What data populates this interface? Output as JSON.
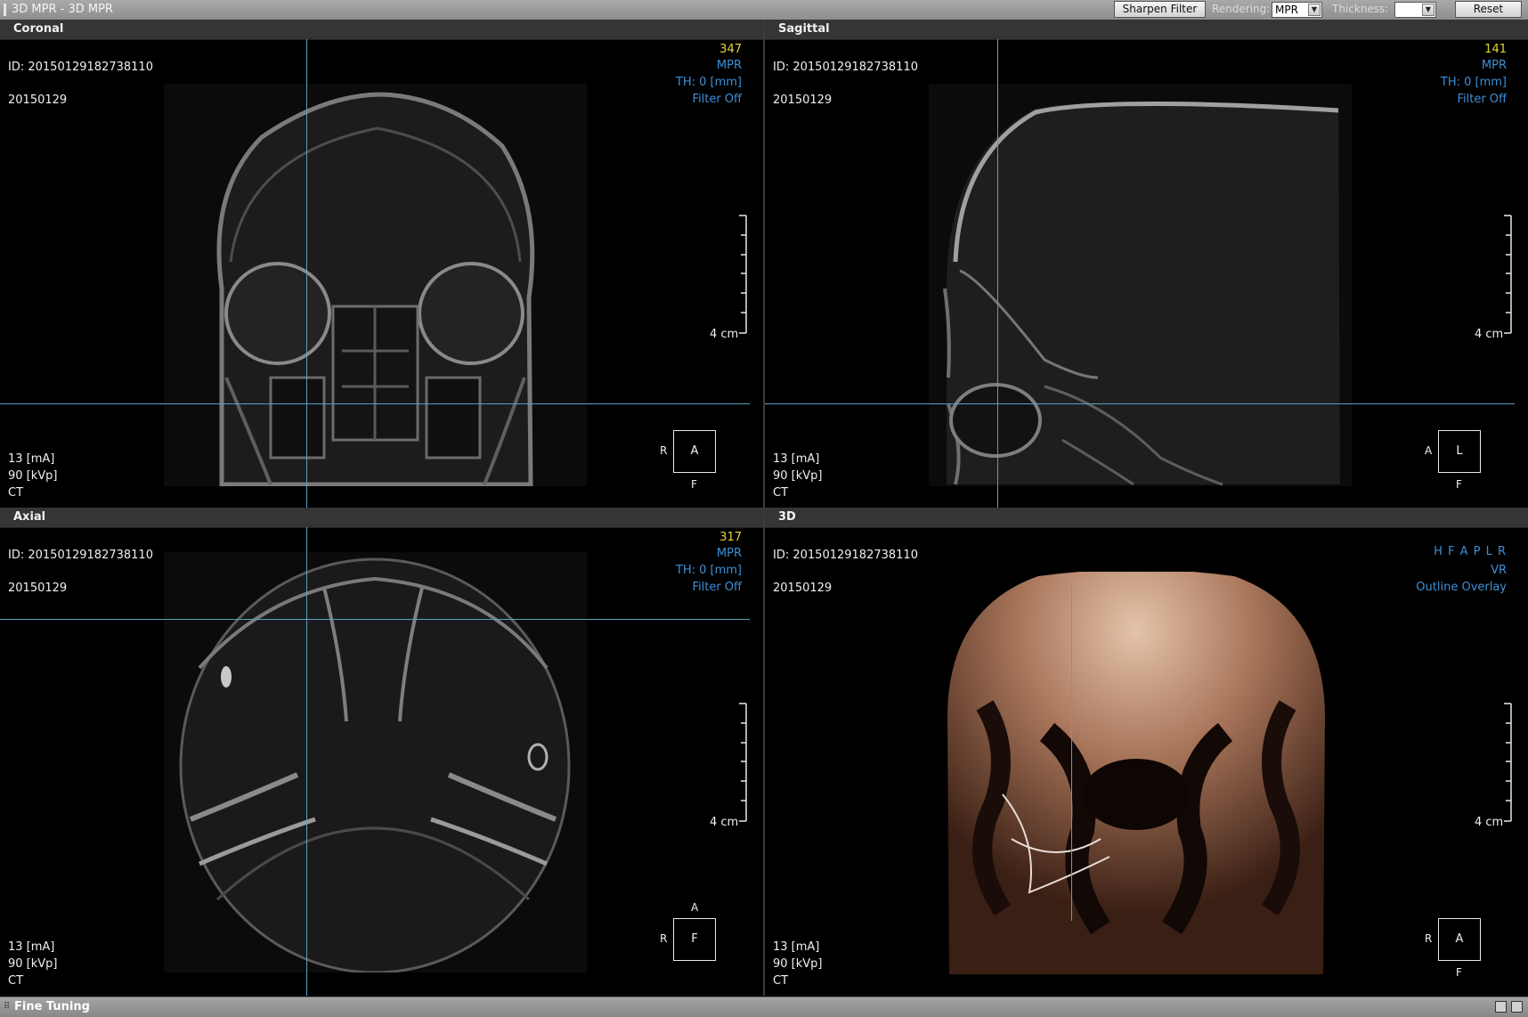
{
  "app": {
    "title": "3D MPR - 3D MPR"
  },
  "toolbar": {
    "sharpen_label": "Sharpen Filter",
    "rendering_label": "Rendering:",
    "rendering_value": "MPR",
    "thickness_label": "Thickness:",
    "thickness_value": "",
    "reset_label": "Reset"
  },
  "viewports": [
    {
      "title": "Coronal",
      "id": "ID: 20150129182738110",
      "date": "20150129",
      "slice": "347",
      "mode": "MPR",
      "thickness": "TH: 0 [mm]",
      "filter": "Filter Off",
      "scale": "4 cm",
      "ma": "13 [mA]",
      "kvp": "90 [kVp]",
      "modality": "CT",
      "orient_center": "A",
      "orient_left": "R",
      "orient_bottom": "F"
    },
    {
      "title": "Sagittal",
      "id": "ID: 20150129182738110",
      "date": "20150129",
      "slice": "141",
      "mode": "MPR",
      "thickness": "TH: 0 [mm]",
      "filter": "Filter Off",
      "scale": "4 cm",
      "ma": "13 [mA]",
      "kvp": "90 [kVp]",
      "modality": "CT",
      "orient_center": "L",
      "orient_left": "A",
      "orient_bottom": "F"
    },
    {
      "title": "Axial",
      "id": "ID: 20150129182738110",
      "date": "20150129",
      "slice": "317",
      "mode": "MPR",
      "thickness": "TH: 0 [mm]",
      "filter": "Filter Off",
      "scale": "4 cm",
      "ma": "13 [mA]",
      "kvp": "90 [kVp]",
      "modality": "CT",
      "orient_center": "F",
      "orient_left": "R",
      "orient_top": "A"
    },
    {
      "title": "3D",
      "id": "ID: 20150129182738110",
      "date": "20150129",
      "directions": "H F A P L R",
      "mode": "VR",
      "overlay": "Outline Overlay",
      "scale": "4 cm",
      "ma": "13 [mA]",
      "kvp": "90 [kVp]",
      "modality": "CT",
      "orient_center": "A",
      "orient_left": "R",
      "orient_bottom": "F"
    }
  ],
  "bottom_panel": {
    "label": "Fine Tuning"
  },
  "icons": {
    "save": "save-icon",
    "folder": "folder-icon",
    "grip": "grip-icon"
  },
  "colors": {
    "crosshair": "#5c9ec4",
    "overlay_blue": "#3d8fd6",
    "slice_yellow": "#e6d33a"
  }
}
